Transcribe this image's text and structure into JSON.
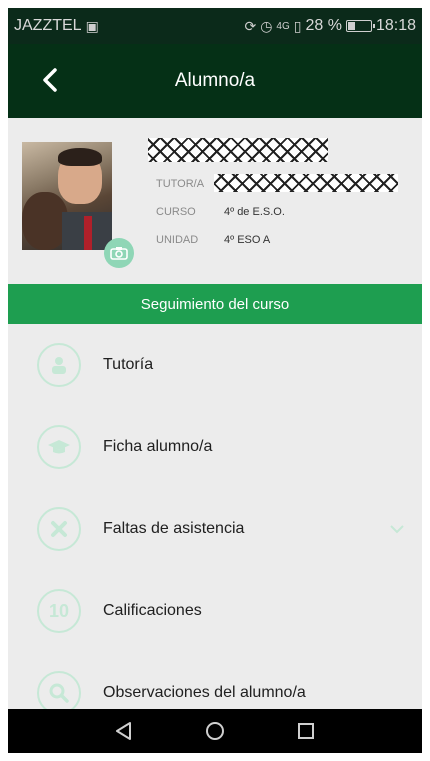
{
  "status_bar": {
    "carrier": "JAZZTEL",
    "network": "4G",
    "battery": "28 %",
    "battery_level": 0.28,
    "time": "18:18"
  },
  "app_bar": {
    "title": "Alumno/a"
  },
  "profile": {
    "tutor_label": "TUTOR/A",
    "course_label": "CURSO",
    "course_value": "4º de E.S.O.",
    "unit_label": "UNIDAD",
    "unit_value": "4º ESO A"
  },
  "section": {
    "title": "Seguimiento del curso"
  },
  "menu": [
    {
      "label": "Tutoría",
      "icon": "person-icon"
    },
    {
      "label": "Ficha alumno/a",
      "icon": "graduation-cap-icon"
    },
    {
      "label": "Faltas de asistencia",
      "icon": "cross-icon"
    },
    {
      "label": "Calificaciones",
      "icon": "number-ten-icon",
      "icon_text": "10"
    },
    {
      "label": "Observaciones del alumno/a",
      "icon": "magnifier-icon"
    }
  ],
  "colors": {
    "app_bar": "#053016",
    "status_bar": "#0b2a1a",
    "section_header": "#1e9e50",
    "icon_tint": "#c6e8d6",
    "background": "#ececec"
  }
}
